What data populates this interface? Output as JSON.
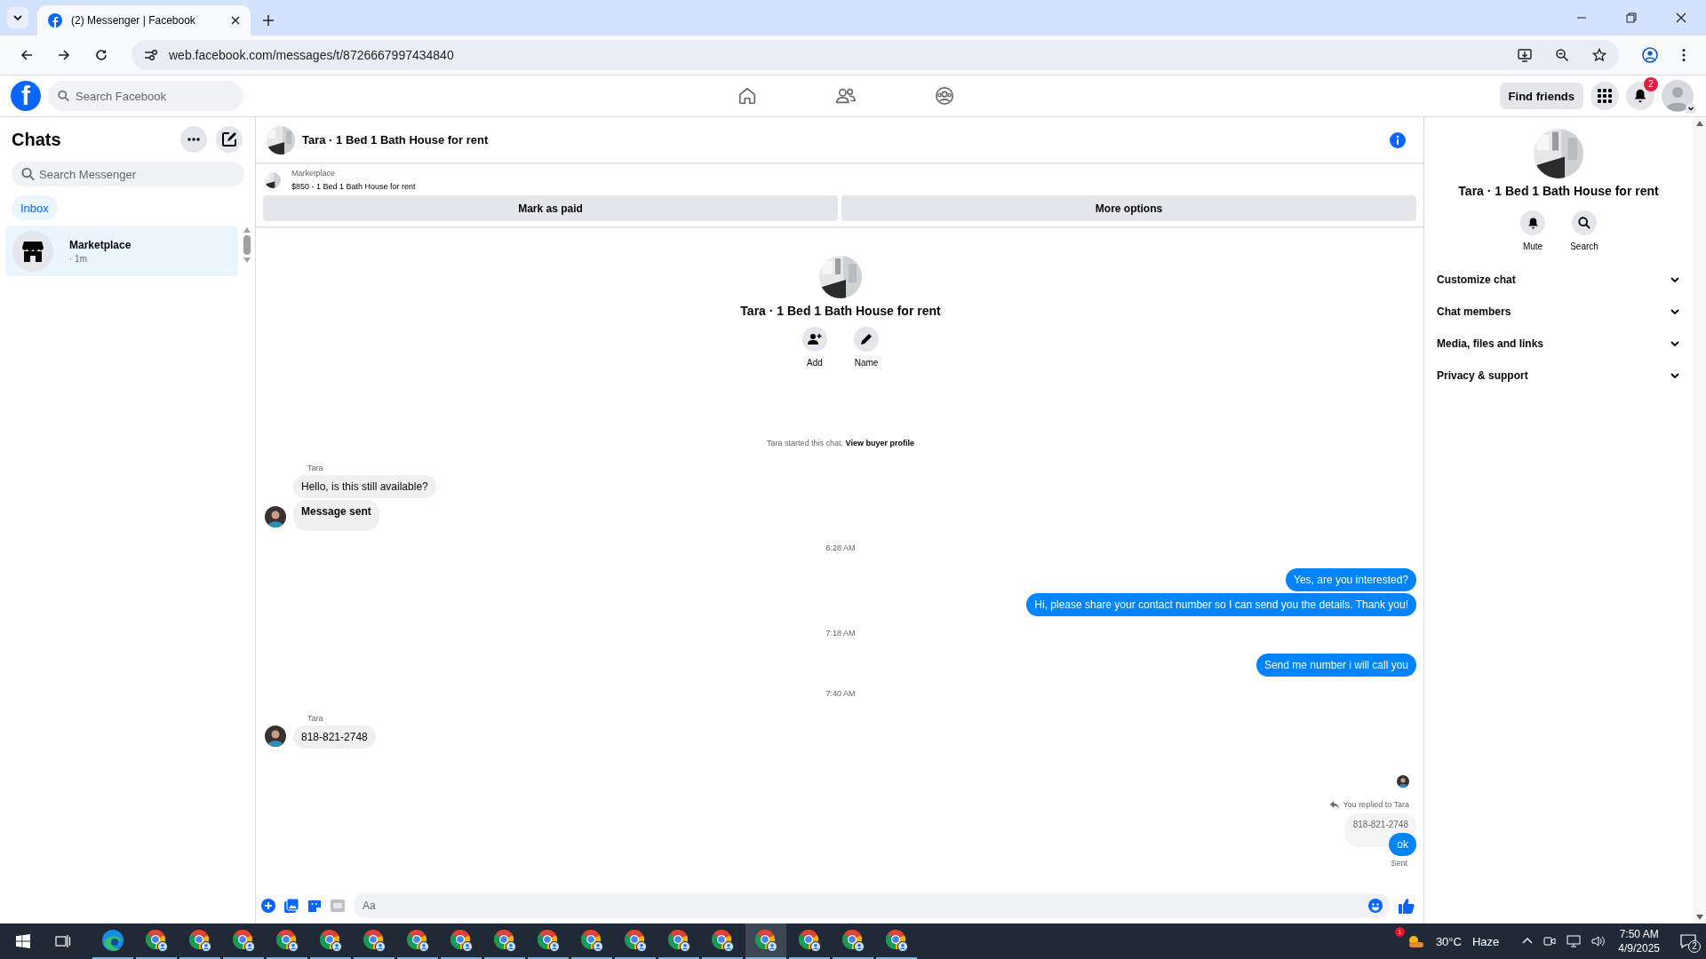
{
  "browser": {
    "tab_title": "(2) Messenger | Facebook",
    "url": "web.facebook.com/messages/t/8726667997434840"
  },
  "topbar": {
    "logo": "f",
    "search_placeholder": "Search Facebook",
    "find_friends": "Find friends",
    "notification_count": "2"
  },
  "sidebar": {
    "title": "Chats",
    "search_placeholder": "Search Messenger",
    "filters": [
      {
        "label": "Inbox",
        "selected": true
      }
    ],
    "chats": [
      {
        "name": "Marketplace",
        "time": "· 1m",
        "selected": true
      }
    ]
  },
  "chat": {
    "title": "Tara · 1 Bed 1 Bath House for rent",
    "listing": {
      "label": "Marketplace",
      "detail": "$850 - 1 Bed 1 Bath House for rent",
      "buttons": [
        "Mark as paid",
        "More options"
      ]
    },
    "intro": {
      "title": "Tara · 1 Bed 1 Bath House for rent",
      "actions": [
        {
          "kind": "add",
          "label": "Add"
        },
        {
          "kind": "name",
          "label": "Name"
        }
      ]
    },
    "notice": {
      "text": "Tara started this chat.",
      "link": "View buyer profile"
    },
    "items": [
      {
        "kind": "incoming",
        "sender": "Tara",
        "bubbles": [
          {
            "text": "Hello, is this still available?",
            "bold": false
          },
          {
            "text": "Message sent",
            "bold": true
          }
        ]
      },
      {
        "kind": "time",
        "text": "6:28 AM"
      },
      {
        "kind": "outgoing",
        "bubbles": [
          "Yes, are you interested?",
          "Hi, please share your contact number so I can send you the details. Thank you!"
        ]
      },
      {
        "kind": "time",
        "text": "7:18 AM"
      },
      {
        "kind": "outgoing",
        "bubbles": [
          "Send me number i will call you"
        ]
      },
      {
        "kind": "time",
        "text": "7:40 AM"
      },
      {
        "kind": "incoming",
        "sender": "Tara",
        "bubbles": [
          {
            "text": "818-821-2748",
            "bold": false
          }
        ]
      },
      {
        "kind": "seen"
      },
      {
        "kind": "reply",
        "label": "You replied to Tara",
        "quoted": "818-821-2748",
        "text": "ok",
        "status": "Sent"
      }
    ],
    "composer_placeholder": "Aa"
  },
  "info": {
    "title": "Tara · 1 Bed 1 Bath House for rent",
    "actions": [
      {
        "kind": "mute",
        "label": "Mute"
      },
      {
        "kind": "search",
        "label": "Search"
      }
    ],
    "sections": [
      {
        "label": "Customize chat",
        "expanded": false
      },
      {
        "label": "Chat members",
        "expanded": false
      },
      {
        "label": "Media, files and links",
        "expanded": false
      },
      {
        "label": "Privacy & support",
        "expanded": false
      }
    ]
  },
  "taskbar": {
    "apps": [
      {
        "kind": "edge",
        "selected": false
      },
      {
        "kind": "chrome",
        "selected": false
      },
      {
        "kind": "chrome",
        "selected": false
      },
      {
        "kind": "chrome",
        "selected": false
      },
      {
        "kind": "chrome",
        "selected": false
      },
      {
        "kind": "chrome",
        "selected": false
      },
      {
        "kind": "chrome",
        "selected": false
      },
      {
        "kind": "chrome",
        "selected": false
      },
      {
        "kind": "chrome",
        "selected": false
      },
      {
        "kind": "chrome",
        "selected": false
      },
      {
        "kind": "chrome",
        "selected": false
      },
      {
        "kind": "chrome",
        "selected": false
      },
      {
        "kind": "chrome",
        "selected": false
      },
      {
        "kind": "chrome",
        "selected": false
      },
      {
        "kind": "chrome",
        "selected": false
      },
      {
        "kind": "chrome",
        "selected": true
      },
      {
        "kind": "chrome",
        "selected": false
      },
      {
        "kind": "chrome",
        "selected": false
      },
      {
        "kind": "chrome",
        "selected": false
      }
    ],
    "weather_alert": "1",
    "temperature": "30°C",
    "condition": "Haze",
    "time": "7:50 AM",
    "date": "4/9/2025",
    "notifications": "2"
  }
}
